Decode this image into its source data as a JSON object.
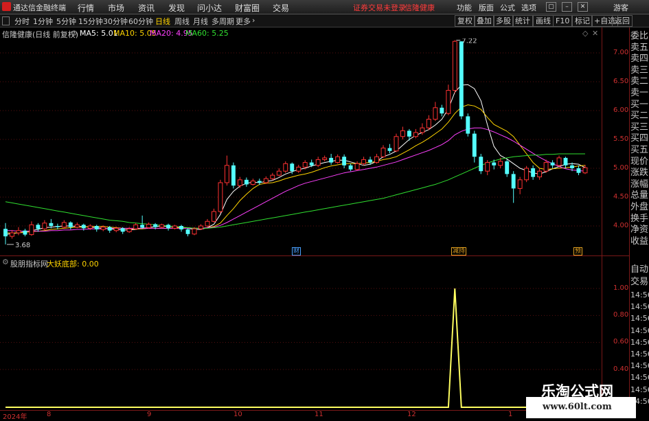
{
  "window": {
    "app_title": "通达信金融终端",
    "menu": [
      "行情",
      "市场",
      "资讯",
      "发现",
      "问小达",
      "财富圈",
      "交易"
    ],
    "warning": "证券交易未登录",
    "stock_highlight": "信隆健康",
    "right_menu": [
      "功能",
      "版面",
      "公式",
      "选项"
    ],
    "user": "游客"
  },
  "toolbar": {
    "periods": [
      "分时",
      "1分钟",
      "5分钟",
      "15分钟",
      "30分钟",
      "60分钟",
      "日线",
      "周线",
      "月线",
      "多周期",
      "更多"
    ],
    "active_period": "日线",
    "right_buttons": [
      "复权",
      "叠加",
      "多股",
      "统计",
      "画线",
      "F10",
      "标记",
      "+自选",
      "返回"
    ]
  },
  "main_chart": {
    "stock_label": "信隆健康(日线 前复权)",
    "ma": [
      {
        "label": "MA5: 5.01",
        "color": "#ffffff"
      },
      {
        "label": "MA10: 5.05",
        "color": "#ffd400"
      },
      {
        "label": "MA20: 4.95",
        "color": "#ff40ff"
      },
      {
        "label": "MA60: 5.25",
        "color": "#30e030"
      }
    ],
    "yticks": [
      "7.00",
      "6.50",
      "6.00",
      "5.50",
      "5.00",
      "4.50",
      "4.00"
    ],
    "high_label": "7.22",
    "low_label": "3.68",
    "events": [
      {
        "label": "财",
        "color": "#4aa0ff"
      },
      {
        "label": "减持",
        "color": "#e0a020"
      },
      {
        "label": "预",
        "color": "#e0a020"
      }
    ]
  },
  "right_panel": {
    "items": [
      "委比",
      "卖五",
      "卖四",
      "卖三",
      "卖二",
      "卖一",
      "买一",
      "买二",
      "买三",
      "买四",
      "买五",
      "现价",
      "涨跌",
      "涨幅",
      "总量",
      "外盘",
      "换手",
      "净资",
      "收益"
    ],
    "lower": [
      "自动",
      "交易"
    ],
    "times": [
      "14:56",
      "14:56",
      "14:56",
      "14:56",
      "14:56",
      "14:56",
      "14:56",
      "14:56",
      "14:56",
      "14:56"
    ]
  },
  "sub_chart": {
    "indicator_name": "股朋指标网",
    "line_label": "大妖底部: 0.00",
    "yticks": [
      "1.00",
      "0.80",
      "0.60",
      "0.40"
    ]
  },
  "x_axis": [
    "2024年",
    "8",
    "9",
    "10",
    "11",
    "12",
    "1"
  ],
  "watermark": {
    "title": "乐淘公式网",
    "url": "www.60lt.com"
  },
  "chart_data": {
    "type": "candlestick",
    "ylim": [
      3.6,
      7.3
    ],
    "high": 7.22,
    "low": 3.68,
    "candles": [
      [
        3.95,
        3.82,
        4.05,
        3.68
      ],
      [
        3.82,
        3.88,
        3.93,
        3.78
      ],
      [
        3.88,
        3.92,
        3.98,
        3.84
      ],
      [
        3.92,
        3.85,
        3.95,
        3.82
      ],
      [
        3.85,
        4.02,
        4.08,
        3.83
      ],
      [
        4.02,
        3.95,
        4.05,
        3.9
      ],
      [
        3.95,
        4.05,
        4.1,
        3.92
      ],
      [
        4.05,
        4.0,
        4.12,
        3.96
      ],
      [
        4.0,
        3.98,
        4.04,
        3.94
      ],
      [
        3.98,
        4.06,
        4.1,
        3.95
      ],
      [
        4.06,
        3.98,
        4.08,
        3.94
      ],
      [
        3.98,
        4.02,
        4.06,
        3.96
      ],
      [
        4.02,
        3.96,
        4.04,
        3.92
      ],
      [
        3.96,
        4.0,
        4.03,
        3.93
      ],
      [
        4.0,
        3.94,
        4.02,
        3.9
      ],
      [
        3.94,
        3.98,
        4.01,
        3.91
      ],
      [
        3.98,
        3.92,
        4.0,
        3.88
      ],
      [
        3.92,
        3.96,
        3.99,
        3.89
      ],
      [
        3.96,
        3.9,
        3.98,
        3.86
      ],
      [
        3.9,
        3.95,
        3.98,
        3.88
      ],
      [
        3.95,
        4.02,
        4.05,
        3.93
      ],
      [
        4.02,
        3.97,
        4.18,
        3.95
      ],
      [
        3.97,
        4.03,
        4.06,
        3.95
      ],
      [
        4.03,
        3.98,
        4.05,
        3.94
      ],
      [
        3.98,
        4.02,
        4.04,
        3.96
      ],
      [
        4.02,
        3.96,
        4.04,
        3.92
      ],
      [
        3.96,
        4.0,
        4.02,
        3.94
      ],
      [
        4.0,
        3.94,
        4.02,
        3.9
      ],
      [
        3.94,
        3.86,
        3.96,
        3.82
      ],
      [
        3.86,
        3.95,
        3.98,
        3.84
      ],
      [
        3.95,
        4.0,
        4.03,
        3.93
      ],
      [
        4.0,
        4.08,
        4.12,
        3.98
      ],
      [
        4.08,
        4.25,
        4.3,
        4.06
      ],
      [
        4.25,
        4.75,
        4.8,
        4.22
      ],
      [
        4.75,
        5.05,
        5.22,
        4.7
      ],
      [
        5.05,
        4.7,
        5.1,
        4.65
      ],
      [
        4.7,
        4.8,
        4.85,
        4.66
      ],
      [
        4.8,
        4.72,
        4.84,
        4.68
      ],
      [
        4.72,
        4.78,
        4.82,
        4.7
      ],
      [
        4.78,
        4.75,
        4.82,
        4.71
      ],
      [
        4.75,
        4.82,
        4.86,
        4.73
      ],
      [
        4.82,
        4.88,
        4.92,
        4.79
      ],
      [
        4.88,
        4.95,
        5.0,
        4.86
      ],
      [
        4.95,
        5.08,
        5.12,
        4.92
      ],
      [
        5.08,
        4.95,
        5.1,
        4.9
      ],
      [
        4.95,
        5.02,
        5.06,
        4.92
      ],
      [
        5.02,
        5.1,
        5.14,
        4.98
      ],
      [
        5.1,
        5.05,
        5.15,
        5.02
      ],
      [
        5.05,
        5.15,
        5.2,
        5.02
      ],
      [
        5.15,
        5.18,
        5.22,
        5.12
      ],
      [
        5.18,
        5.1,
        5.25,
        5.06
      ],
      [
        5.1,
        5.2,
        5.24,
        5.08
      ],
      [
        5.2,
        5.05,
        5.24,
        5.0
      ],
      [
        5.05,
        4.98,
        5.08,
        4.95
      ],
      [
        4.98,
        5.08,
        5.12,
        4.96
      ],
      [
        5.08,
        5.15,
        5.2,
        5.05
      ],
      [
        5.15,
        5.1,
        5.2,
        5.06
      ],
      [
        5.1,
        5.2,
        5.25,
        5.08
      ],
      [
        5.2,
        5.35,
        5.4,
        5.18
      ],
      [
        5.35,
        5.3,
        5.42,
        5.26
      ],
      [
        5.3,
        5.55,
        5.6,
        5.28
      ],
      [
        5.55,
        5.65,
        5.72,
        5.5
      ],
      [
        5.65,
        5.55,
        5.68,
        5.48
      ],
      [
        5.55,
        5.62,
        5.68,
        5.52
      ],
      [
        5.62,
        5.7,
        5.78,
        5.58
      ],
      [
        5.7,
        5.85,
        5.92,
        5.66
      ],
      [
        5.85,
        6.05,
        6.15,
        5.82
      ],
      [
        6.05,
        5.95,
        6.1,
        5.9
      ],
      [
        5.95,
        6.35,
        6.45,
        5.92
      ],
      [
        6.35,
        7.2,
        7.22,
        6.3
      ],
      [
        7.2,
        5.9,
        7.15,
        5.85
      ],
      [
        5.9,
        5.6,
        5.95,
        5.55
      ],
      [
        5.6,
        5.2,
        5.65,
        5.1
      ],
      [
        5.2,
        4.95,
        5.25,
        4.9
      ],
      [
        4.95,
        5.1,
        5.14,
        4.88
      ],
      [
        5.1,
        5.05,
        5.15,
        4.98
      ],
      [
        5.05,
        5.12,
        5.18,
        5.0
      ],
      [
        5.12,
        4.9,
        5.15,
        4.85
      ],
      [
        4.9,
        4.65,
        4.95,
        4.4
      ],
      [
        4.65,
        4.8,
        4.85,
        4.55
      ],
      [
        4.8,
        5.0,
        5.04,
        4.76
      ],
      [
        5.0,
        4.85,
        5.05,
        4.8
      ],
      [
        4.85,
        4.95,
        5.0,
        4.8
      ],
      [
        4.95,
        5.1,
        5.15,
        4.92
      ],
      [
        5.1,
        5.05,
        5.14,
        5.0
      ],
      [
        5.05,
        5.18,
        5.22,
        5.02
      ],
      [
        5.18,
        5.05,
        5.2,
        5.0
      ],
      [
        5.05,
        5.0,
        5.1,
        4.95
      ],
      [
        5.0,
        4.92,
        5.05,
        4.88
      ],
      [
        4.92,
        5.01,
        5.06,
        4.9
      ]
    ],
    "ma_series": {
      "MA5": [
        3.85,
        3.87,
        3.88,
        3.9,
        3.92,
        3.94,
        3.97,
        3.98,
        3.99,
        4.0,
        4.0,
        3.99,
        3.99,
        3.98,
        3.97,
        3.96,
        3.95,
        3.94,
        3.93,
        3.93,
        3.94,
        3.96,
        3.97,
        3.99,
        4.0,
        3.99,
        3.99,
        3.98,
        3.96,
        3.94,
        3.94,
        3.97,
        4.03,
        4.2,
        4.46,
        4.6,
        4.69,
        4.74,
        4.76,
        4.75,
        4.77,
        4.79,
        4.84,
        4.9,
        4.94,
        4.98,
        5.0,
        5.04,
        5.07,
        5.1,
        5.12,
        5.14,
        5.14,
        5.11,
        5.08,
        5.05,
        5.07,
        5.12,
        5.2,
        5.24,
        5.3,
        5.4,
        5.5,
        5.57,
        5.62,
        5.67,
        5.75,
        5.85,
        6.03,
        6.32,
        6.44,
        6.45,
        6.38,
        6.17,
        5.75,
        5.38,
        5.22,
        5.16,
        5.08,
        5.0,
        4.96,
        4.92,
        4.9,
        4.94,
        4.99,
        5.03,
        5.07,
        5.08,
        5.07,
        5.01
      ],
      "MA10": [
        3.88,
        3.88,
        3.88,
        3.89,
        3.9,
        3.91,
        3.92,
        3.94,
        3.95,
        3.96,
        3.97,
        3.98,
        3.98,
        3.99,
        3.99,
        3.99,
        3.98,
        3.97,
        3.96,
        3.95,
        3.95,
        3.95,
        3.96,
        3.96,
        3.96,
        3.96,
        3.97,
        3.97,
        3.97,
        3.96,
        3.96,
        3.97,
        3.99,
        4.05,
        4.18,
        4.3,
        4.44,
        4.55,
        4.65,
        4.72,
        4.74,
        4.75,
        4.78,
        4.82,
        4.85,
        4.88,
        4.9,
        4.93,
        4.97,
        5.01,
        5.04,
        5.06,
        5.08,
        5.08,
        5.08,
        5.09,
        5.1,
        5.12,
        5.15,
        5.17,
        5.2,
        5.26,
        5.32,
        5.39,
        5.45,
        5.52,
        5.6,
        5.68,
        5.8,
        5.95,
        6.06,
        6.1,
        6.08,
        6.02,
        5.88,
        5.76,
        5.7,
        5.64,
        5.55,
        5.4,
        5.25,
        5.1,
        5.0,
        4.98,
        4.99,
        5.0,
        5.01,
        5.02,
        5.04,
        5.05
      ],
      "MA20": [
        3.92,
        3.92,
        3.91,
        3.91,
        3.91,
        3.91,
        3.91,
        3.92,
        3.92,
        3.93,
        3.93,
        3.94,
        3.94,
        3.95,
        3.95,
        3.95,
        3.96,
        3.96,
        3.96,
        3.96,
        3.96,
        3.96,
        3.96,
        3.96,
        3.96,
        3.96,
        3.96,
        3.96,
        3.96,
        3.96,
        3.96,
        3.97,
        3.98,
        4.01,
        4.06,
        4.12,
        4.18,
        4.24,
        4.3,
        4.36,
        4.42,
        4.48,
        4.54,
        4.6,
        4.65,
        4.7,
        4.74,
        4.77,
        4.8,
        4.83,
        4.86,
        4.89,
        4.92,
        4.94,
        4.96,
        4.98,
        5.0,
        5.02,
        5.05,
        5.08,
        5.11,
        5.15,
        5.19,
        5.23,
        5.27,
        5.31,
        5.36,
        5.41,
        5.48,
        5.58,
        5.64,
        5.68,
        5.7,
        5.7,
        5.67,
        5.63,
        5.58,
        5.53,
        5.47,
        5.4,
        5.33,
        5.26,
        5.19,
        5.13,
        5.08,
        5.03,
        4.99,
        4.97,
        4.96,
        4.95
      ],
      "MA60": [
        4.42,
        4.4,
        4.38,
        4.36,
        4.34,
        4.32,
        4.3,
        4.28,
        4.26,
        4.24,
        4.22,
        4.2,
        4.18,
        4.16,
        4.14,
        4.12,
        4.1,
        4.09,
        4.08,
        4.06,
        4.05,
        4.04,
        4.03,
        4.02,
        4.01,
        4.0,
        3.99,
        3.98,
        3.97,
        3.96,
        3.96,
        3.96,
        3.97,
        3.98,
        4.0,
        4.02,
        4.04,
        4.06,
        4.08,
        4.1,
        4.12,
        4.14,
        4.16,
        4.18,
        4.2,
        4.22,
        4.24,
        4.26,
        4.28,
        4.3,
        4.32,
        4.34,
        4.36,
        4.38,
        4.4,
        4.42,
        4.44,
        4.46,
        4.48,
        4.51,
        4.54,
        4.57,
        4.6,
        4.63,
        4.66,
        4.69,
        4.72,
        4.76,
        4.8,
        4.85,
        4.9,
        4.95,
        5.0,
        5.05,
        5.09,
        5.13,
        5.16,
        5.18,
        5.2,
        5.21,
        5.22,
        5.23,
        5.23,
        5.24,
        5.24,
        5.25,
        5.25,
        5.25,
        5.25,
        5.25
      ]
    },
    "indicator": {
      "name": "大妖底部",
      "ylim": [
        0,
        1.05
      ],
      "nonzero_index": 69,
      "nonzero_value": 1.0
    }
  }
}
